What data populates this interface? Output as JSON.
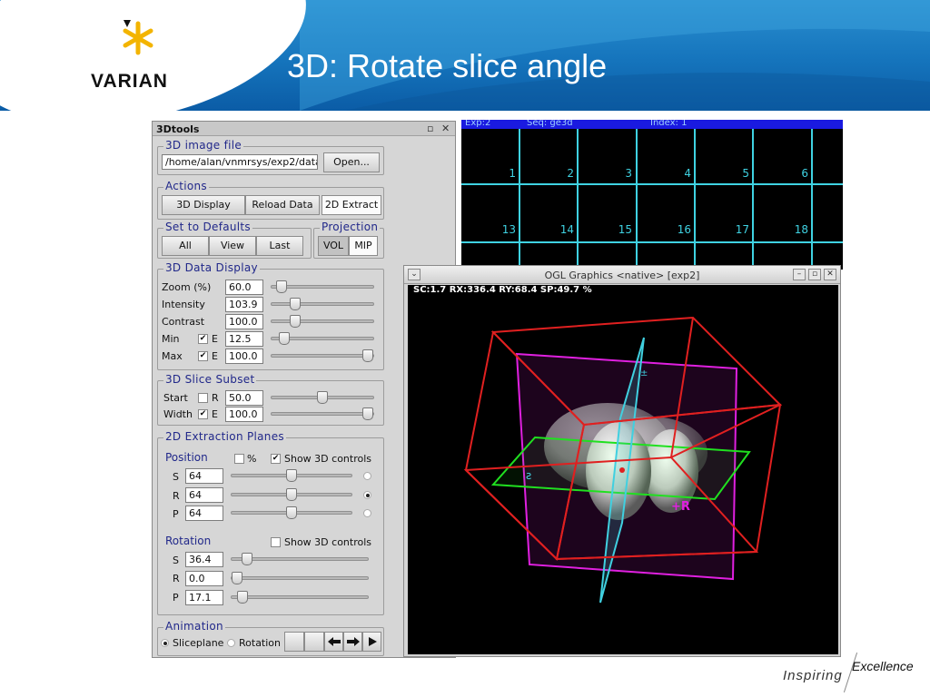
{
  "slide": {
    "title": "3D: Rotate slice angle",
    "logo_text": "VARIAN",
    "footer_inspiring": "Inspiring",
    "footer_excellence": "Excellence"
  },
  "tools": {
    "title": "3Dtools",
    "pin_icon": "pin-icon",
    "close_icon": "close-icon",
    "image_file": {
      "legend": "3D image file",
      "path": "/home/alan/vnmrsys/exp2/data",
      "open_label": "Open..."
    },
    "actions": {
      "legend": "Actions",
      "display": "3D Display",
      "reload": "Reload Data",
      "extract": "2D Extract"
    },
    "defaults": {
      "legend": "Set to Defaults",
      "all": "All",
      "view": "View",
      "last": "Last"
    },
    "projection": {
      "legend": "Projection",
      "vol": "VOL",
      "mip": "MIP"
    },
    "data_display": {
      "legend": "3D Data Display",
      "zoom_label": "Zoom (%)",
      "zoom_value": "60.0",
      "zoom_level": 0.05,
      "intensity_label": "Intensity",
      "intensity_value": "103.9",
      "intensity_level": 0.2,
      "contrast_label": "Contrast",
      "contrast_value": "100.0",
      "contrast_level": 0.2,
      "min_label": "Min",
      "min_e": "E",
      "min_value": "12.5",
      "min_level": 0.08,
      "max_label": "Max",
      "max_e": "E",
      "max_value": "100.0",
      "max_level": 1.0
    },
    "slice_subset": {
      "legend": "3D Slice Subset",
      "start_label": "Start",
      "start_r": "R",
      "start_value": "50.0",
      "start_level": 0.5,
      "width_label": "Width",
      "width_e": "E",
      "width_value": "100.0",
      "width_level": 1.0
    },
    "extraction": {
      "legend": "2D Extraction Planes",
      "position_label": "Position",
      "percent_label": "%",
      "show3d_label": "Show 3D controls",
      "s_label": "S",
      "s_value": "64",
      "s_level": 0.5,
      "r_label": "R",
      "r_value": "64",
      "r_level": 0.5,
      "p_label": "P",
      "p_value": "64",
      "p_level": 0.5,
      "rotation_label": "Rotation",
      "rot_show3d_label": "Show 3D controls",
      "rs_label": "S",
      "rs_value": "36.4",
      "rs_level": 0.08,
      "rr_label": "R",
      "rr_value": "0.0",
      "rr_level": 0.0,
      "rp_label": "P",
      "rp_value": "17.1",
      "rp_level": 0.04
    },
    "animation": {
      "legend": "Animation",
      "sliceplane": "Sliceplane",
      "rotation": "Rotation"
    }
  },
  "grid": {
    "exp": "Exp:2",
    "seq": "Seq: ge3d",
    "index": "Index: 1",
    "row1": [
      "1",
      "2",
      "3",
      "4",
      "5",
      "6"
    ],
    "row2": [
      "13",
      "14",
      "15",
      "16",
      "17",
      "18"
    ]
  },
  "ogl": {
    "title": "OGL Graphics <native> [exp2]",
    "status": "SC:1.7  RX:336.4  RY:68.4  SP:49.7 %",
    "label_plus_r": "+R",
    "colors": {
      "cube": "#e02020",
      "sagittal": "#e020e0",
      "axial": "#20e020",
      "coronal": "#40d0e0"
    }
  }
}
